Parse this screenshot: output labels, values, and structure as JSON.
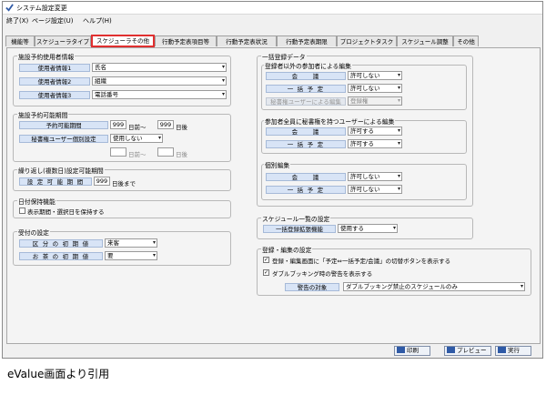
{
  "window": {
    "title": "システム設定変更"
  },
  "menu": [
    "終了(X)",
    "ページ設定(U)",
    "ヘルプ(H)"
  ],
  "tabs": [
    "機能等",
    "スケジューラタイプ",
    "スケジューラその他",
    "行動予定表項目等",
    "行動予定表状況",
    "行動予定表期限",
    "プロジェクトタスク",
    "スケジュール調整",
    "その他"
  ],
  "active_tab": 2,
  "facility_user": {
    "title": "施設予約使用者情報",
    "rows": [
      {
        "label": "使用者情報1",
        "value": "氏名"
      },
      {
        "label": "使用者情報2",
        "value": "組織"
      },
      {
        "label": "使用者情報3",
        "value": "電話番号"
      }
    ]
  },
  "facility_period": {
    "title": "施設予約可能期間",
    "reserve_label": "予約可能期間",
    "days_before": "999",
    "days_before_unit": "日前～",
    "days_after": "999",
    "days_after_unit": "日後",
    "secretary_label": "秘書権ユーザー個別設定",
    "secretary_value": "使用しない",
    "disabled_before_unit": "日前～",
    "disabled_after_unit": "日後"
  },
  "repeat": {
    "title": "繰り返し(複数日)設定可能期間",
    "label": "設 定 可 能 期 間",
    "value": "999",
    "unit": "日後まで"
  },
  "date_keep": {
    "title": "日付保持機能",
    "checkbox_label": "表示期間・選択日を保持する",
    "checked": false
  },
  "reception": {
    "title": "受付の設定",
    "rows": [
      {
        "label": "区 分 の 初 期 値",
        "value": "来客"
      },
      {
        "label": "お 茶 の 初 期 値",
        "value": "要"
      }
    ]
  },
  "bulk": {
    "title": "一括登録データ",
    "sub1": {
      "title": "登録者以外の参加者による編集",
      "rows": [
        {
          "label": "会　　議",
          "value": "許可しない",
          "disabled": false
        },
        {
          "label": "一 括 予 定",
          "value": "許可しない",
          "disabled": false
        },
        {
          "label": "秘書権ユーザーによる編集",
          "value": "登録権",
          "disabled": true
        }
      ]
    },
    "sub2": {
      "title": "参加者全員に秘書権を持つユーザーによる編集",
      "rows": [
        {
          "label": "会　　議",
          "value": "許可する"
        },
        {
          "label": "一 括 予 定",
          "value": "許可する"
        }
      ]
    },
    "sub3": {
      "title": "個別編集",
      "rows": [
        {
          "label": "会　　議",
          "value": "許可しない"
        },
        {
          "label": "一 括 予 定",
          "value": "許可しない"
        }
      ]
    }
  },
  "schedule_list": {
    "title": "スケジュール一覧の設定",
    "label": "一括登録拡張機能",
    "value": "使用する"
  },
  "reg_edit": {
    "title": "登録・編集の設定",
    "check1": "登録・編集画面に「予定⇔一括予定/会議」の切替ボタンを表示する",
    "check1_checked": true,
    "check2": "ダブルブッキング時の警告を表示する",
    "check2_checked": true,
    "warn_label": "警告の対象",
    "warn_value": "ダブルブッキング禁止のスケジュールのみ"
  },
  "footer": {
    "print": "印刷",
    "preview": "プレビュー",
    "run": "実行"
  },
  "caption": "eValue画面より引用",
  "colors": {
    "label_bg": "#d8e4f6",
    "active_tab_border": "#e03030",
    "button_icon": "#2f5aa6"
  }
}
